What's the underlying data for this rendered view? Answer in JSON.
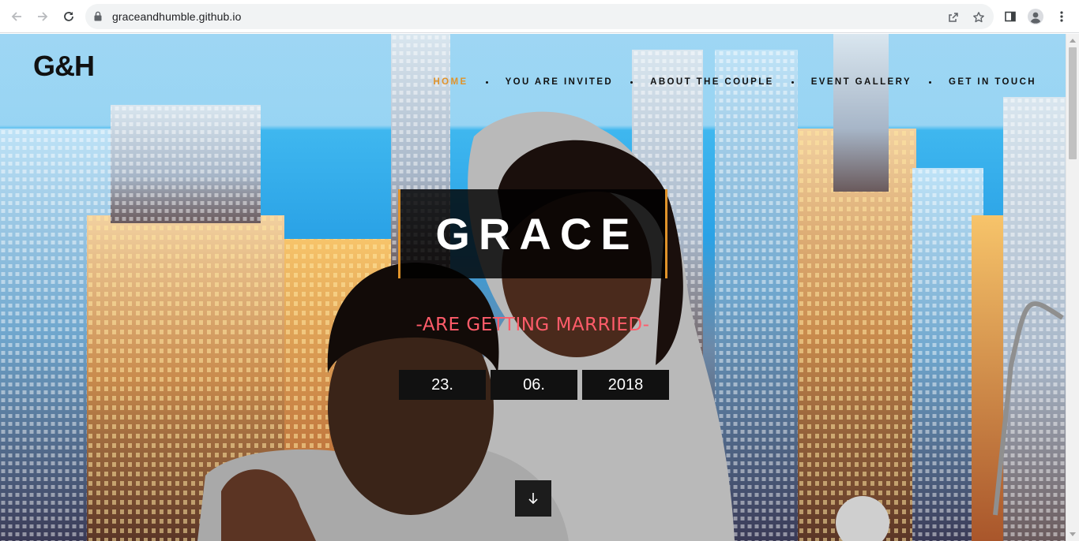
{
  "browser": {
    "url": "graceandhumble.github.io",
    "icons": {
      "back": "arrow-left-icon",
      "forward": "arrow-right-icon",
      "reload": "reload-icon",
      "lock": "lock-icon",
      "share": "share-icon",
      "bookmark": "star-icon",
      "side_panel": "side-panel-icon",
      "profile": "profile-icon",
      "menu": "kebab-menu-icon"
    }
  },
  "site": {
    "logo": "G&H",
    "nav": [
      {
        "label": "HOME",
        "active": true
      },
      {
        "label": "YOU ARE INVITED",
        "active": false
      },
      {
        "label": "ABOUT THE COUPLE",
        "active": false
      },
      {
        "label": "EVENT GALLERY",
        "active": false
      },
      {
        "label": "GET IN TOUCH",
        "active": false
      }
    ],
    "hero": {
      "name": "GRACE",
      "tagline": "-ARE GETTING MARRIED-",
      "date": {
        "day": "23.",
        "month": "06.",
        "year": "2018"
      },
      "scroll_icon": "arrow-down-icon"
    },
    "colors": {
      "accent": "#e0932a",
      "tagline": "#ff5c6a",
      "box_bg": "#111111"
    }
  }
}
